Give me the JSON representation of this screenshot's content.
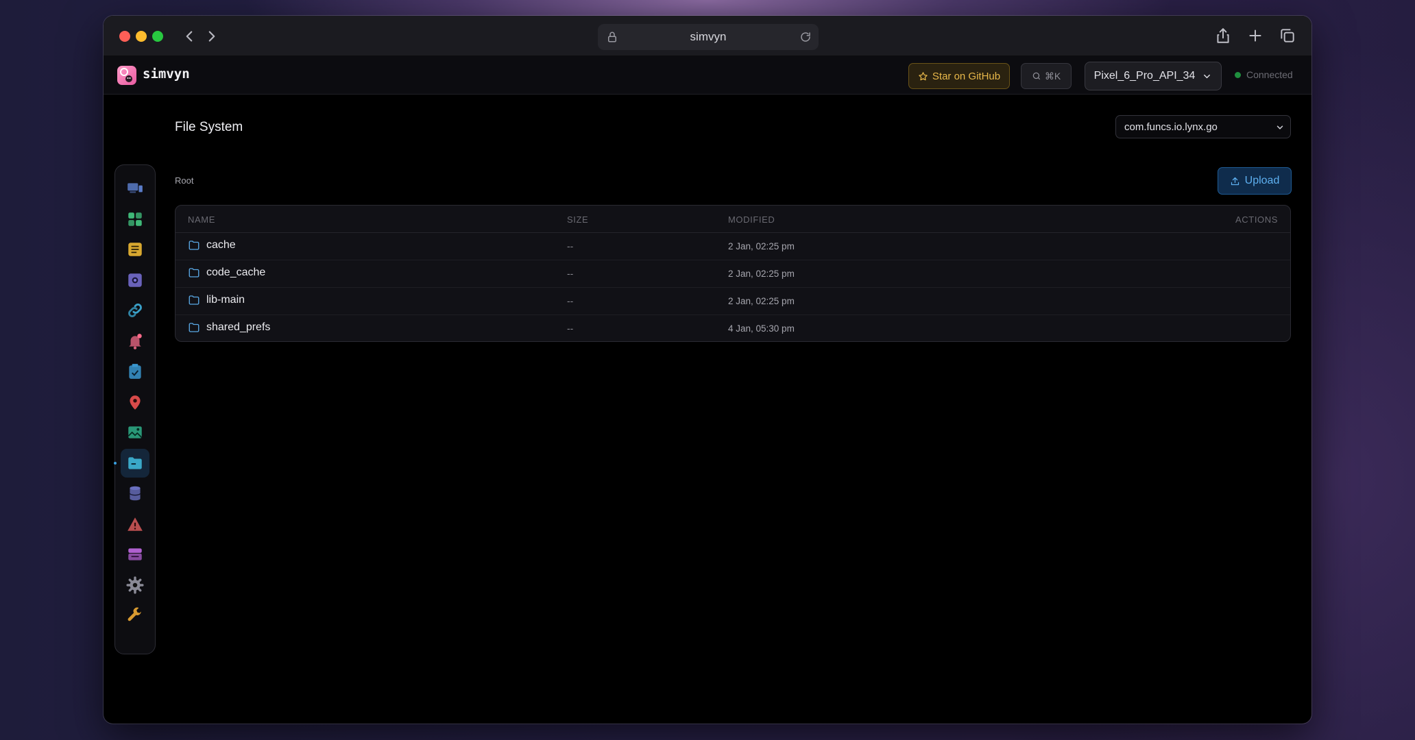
{
  "browser": {
    "url": "simvyn"
  },
  "app": {
    "name": "simvyn",
    "star_label": "Star on GitHub",
    "search_shortcut": "⌘K",
    "device": "Pixel_6_Pro_API_34",
    "status": "Connected"
  },
  "sidebar": {
    "items": [
      {
        "icon": "devices-icon",
        "color": "#5a7cc8"
      },
      {
        "icon": "apps-grid-icon",
        "color": "#3fb878"
      },
      {
        "icon": "logs-icon",
        "color": "#d8a830"
      },
      {
        "icon": "screenshot-icon",
        "color": "#7a72d8"
      },
      {
        "icon": "deep-link-icon",
        "color": "#3aa0c8"
      },
      {
        "icon": "notification-bell-icon",
        "color": "#d8607a"
      },
      {
        "icon": "clipboard-icon",
        "color": "#3a98d0"
      },
      {
        "icon": "location-pin-icon",
        "color": "#d84a4a"
      },
      {
        "icon": "media-image-icon",
        "color": "#2fb08a"
      },
      {
        "icon": "folder-icon",
        "color": "#3aa8c8",
        "active": true
      },
      {
        "icon": "database-icon",
        "color": "#6a70c0"
      },
      {
        "icon": "crash-warning-icon",
        "color": "#d85a5a"
      },
      {
        "icon": "layers-icon",
        "color": "#b060d0"
      },
      {
        "icon": "settings-gear-icon",
        "color": "#8a8a96"
      },
      {
        "icon": "wrench-tools-icon",
        "color": "#d89a30"
      }
    ]
  },
  "page": {
    "title": "File System",
    "package": "com.funcs.io.lynx.go",
    "breadcrumb": "Root",
    "upload_label": "Upload"
  },
  "table": {
    "headers": {
      "name": "NAME",
      "size": "SIZE",
      "modified": "MODIFIED",
      "actions": "ACTIONS"
    },
    "rows": [
      {
        "name": "cache",
        "size": "--",
        "modified": "2 Jan, 02:25 pm"
      },
      {
        "name": "code_cache",
        "size": "--",
        "modified": "2 Jan, 02:25 pm"
      },
      {
        "name": "lib-main",
        "size": "--",
        "modified": "2 Jan, 02:25 pm"
      },
      {
        "name": "shared_prefs",
        "size": "--",
        "modified": "4 Jan, 05:30 pm"
      }
    ]
  }
}
